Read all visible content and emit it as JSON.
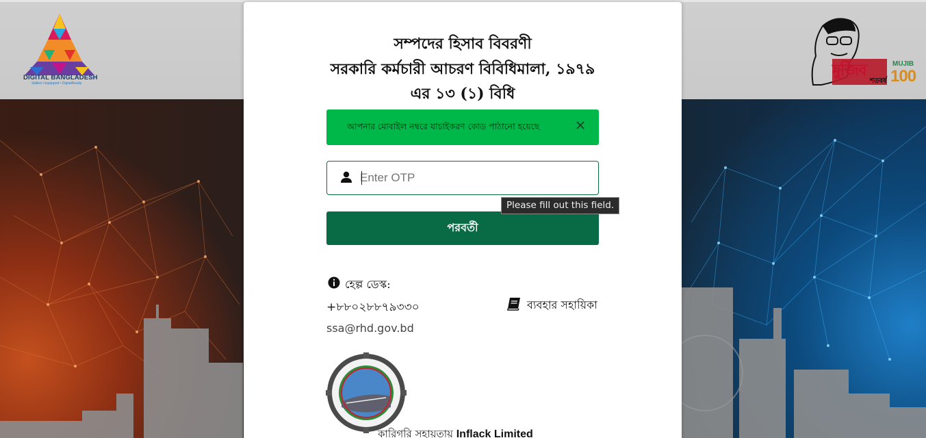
{
  "header": {
    "left_logo": {
      "title": "DIGITAL BANGLADESH",
      "tagline": "Skilled • Equipped • DigitalReady"
    },
    "right_logo": {
      "bangla_name": "মুজিব",
      "bangla_subtitle": "শতবর্ষ",
      "english_name": "MUJIB",
      "number": "100"
    }
  },
  "card": {
    "title_line1": "সম্পদের হিসাব বিবরণী",
    "title_line2": "সরকারি কর্মচারী আচরণ বিবিধিমালা, ১৯৭৯",
    "title_line3": "এর ১৩ (১) বিধি",
    "alert": {
      "message": "আপনার মোবাইল নম্বরে যাচাইকরণ কোড পাঠানো হয়েছে",
      "close_icon": "close-icon",
      "color": "#00b84a"
    },
    "otp": {
      "placeholder": "Enter OTP",
      "value": "",
      "icon": "user-icon"
    },
    "validation_tooltip": "Please fill out this field.",
    "next_button": {
      "label": "পরবর্তী",
      "color": "#086b45"
    },
    "help": {
      "label": "হেল্প ডেস্ক:",
      "phone": "+৮৮০২৮৮৭৯৩৩০",
      "email": "ssa@rhd.gov.bd",
      "icon": "info-icon"
    },
    "guide": {
      "label": "ব্যবহার সহায়িকা",
      "icon": "book-icon"
    },
    "footer": {
      "prefix": "কারিগরি সহায়তায়",
      "company": "Inflack Limited"
    }
  }
}
